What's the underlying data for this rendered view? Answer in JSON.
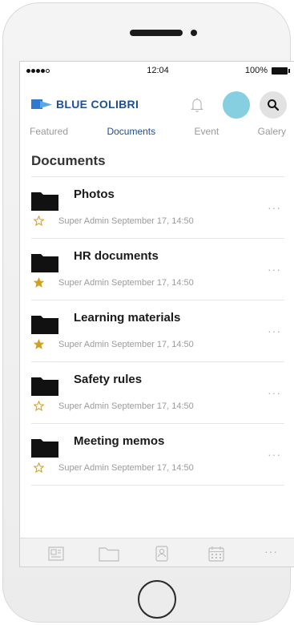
{
  "status_bar": {
    "time": "12:04",
    "battery": "100%"
  },
  "header": {
    "brand": "BLUE COLIBRI"
  },
  "tabs": [
    {
      "label": "Featured",
      "active": false
    },
    {
      "label": "Documents",
      "active": true
    },
    {
      "label": "Event",
      "active": false
    },
    {
      "label": "Galery",
      "active": false
    }
  ],
  "section": {
    "title": "Documents"
  },
  "documents": [
    {
      "title": "Photos",
      "meta": "Super Admin September 17, 14:50",
      "starred": false
    },
    {
      "title": "HR documents",
      "meta": "Super Admin September 17, 14:50",
      "starred": true
    },
    {
      "title": "Learning materials",
      "meta": "Super Admin September 17, 14:50",
      "starred": true
    },
    {
      "title": "Safety rules",
      "meta": "Super Admin September 17, 14:50",
      "starred": false
    },
    {
      "title": "Meeting memos",
      "meta": "Super Admin September 17, 14:50",
      "starred": false
    }
  ],
  "more_glyph": "···",
  "colors": {
    "brand": "#1d4f91",
    "avatar": "#86cfe0",
    "star": "#d4a017"
  }
}
